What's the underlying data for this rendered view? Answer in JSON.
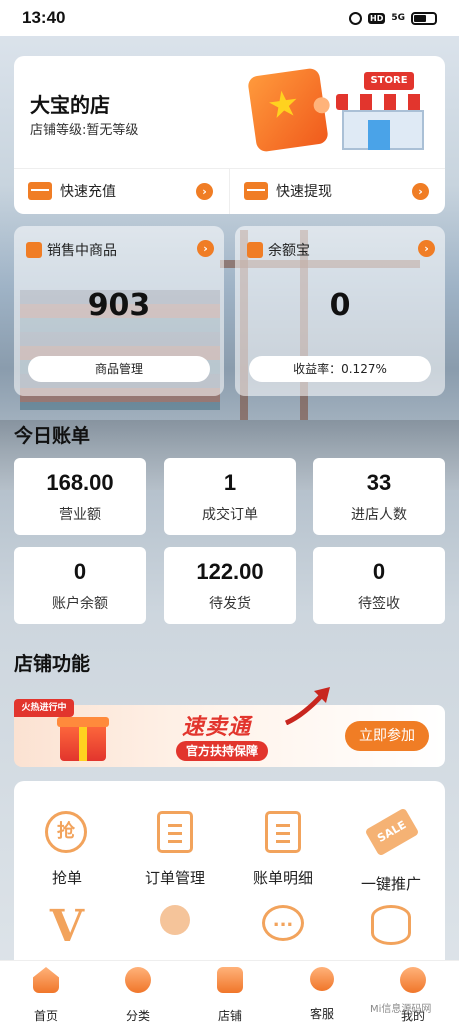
{
  "status_bar": {
    "time": "13:40",
    "icons": [
      "alarm-icon",
      "hd-icon",
      "signal-icon",
      "battery-icon"
    ],
    "hd_label": "HD",
    "signal_label": "5G"
  },
  "store": {
    "name": "大宝的店",
    "level": "店铺等级:暂无等级",
    "sign_text": "STORE",
    "quick_actions": [
      {
        "label": "快速充值",
        "icon": "card-icon"
      },
      {
        "label": "快速提现",
        "icon": "wallet-icon"
      }
    ]
  },
  "info_cards": [
    {
      "title": "销售中商品",
      "value": "903",
      "button": "商品管理",
      "icon": "bag-icon"
    },
    {
      "title": "余额宝",
      "value": "0",
      "button": "收益率：0.127%",
      "icon": "coin-icon"
    }
  ],
  "today": {
    "title": "今日账单",
    "stats": [
      {
        "value": "168.00",
        "label": "营业额"
      },
      {
        "value": "1",
        "label": "成交订单"
      },
      {
        "value": "33",
        "label": "进店人数"
      },
      {
        "value": "0",
        "label": "账户余额"
      },
      {
        "value": "122.00",
        "label": "待发货"
      },
      {
        "value": "0",
        "label": "待签收"
      }
    ]
  },
  "functions": {
    "title": "店铺功能",
    "banner": {
      "tag": "火热进行中",
      "title": "速卖通",
      "subtitle": "官方扶持保障",
      "button": "立即参加"
    },
    "items": [
      {
        "label": "抢单",
        "icon": "grab-order-icon",
        "glyph": "抢"
      },
      {
        "label": "订单管理",
        "icon": "order-manage-icon"
      },
      {
        "label": "账单明细",
        "icon": "bill-detail-icon"
      },
      {
        "label": "一键推广",
        "icon": "promote-tag-icon",
        "glyph": "SALE"
      },
      {
        "label": "",
        "icon": "vip-icon",
        "glyph": "V"
      },
      {
        "label": "",
        "icon": "team-icon"
      },
      {
        "label": "",
        "icon": "chat-icon",
        "glyph": "..."
      },
      {
        "label": "",
        "icon": "coins-icon"
      }
    ]
  },
  "bottom_nav": [
    {
      "label": "首页",
      "icon": "home-icon"
    },
    {
      "label": "分类",
      "icon": "category-icon"
    },
    {
      "label": "店铺",
      "icon": "shop-icon"
    },
    {
      "label": "客服",
      "icon": "customer-service-icon"
    },
    {
      "label": "我的",
      "icon": "profile-icon"
    }
  ],
  "watermark": "Mi信息源码网"
}
